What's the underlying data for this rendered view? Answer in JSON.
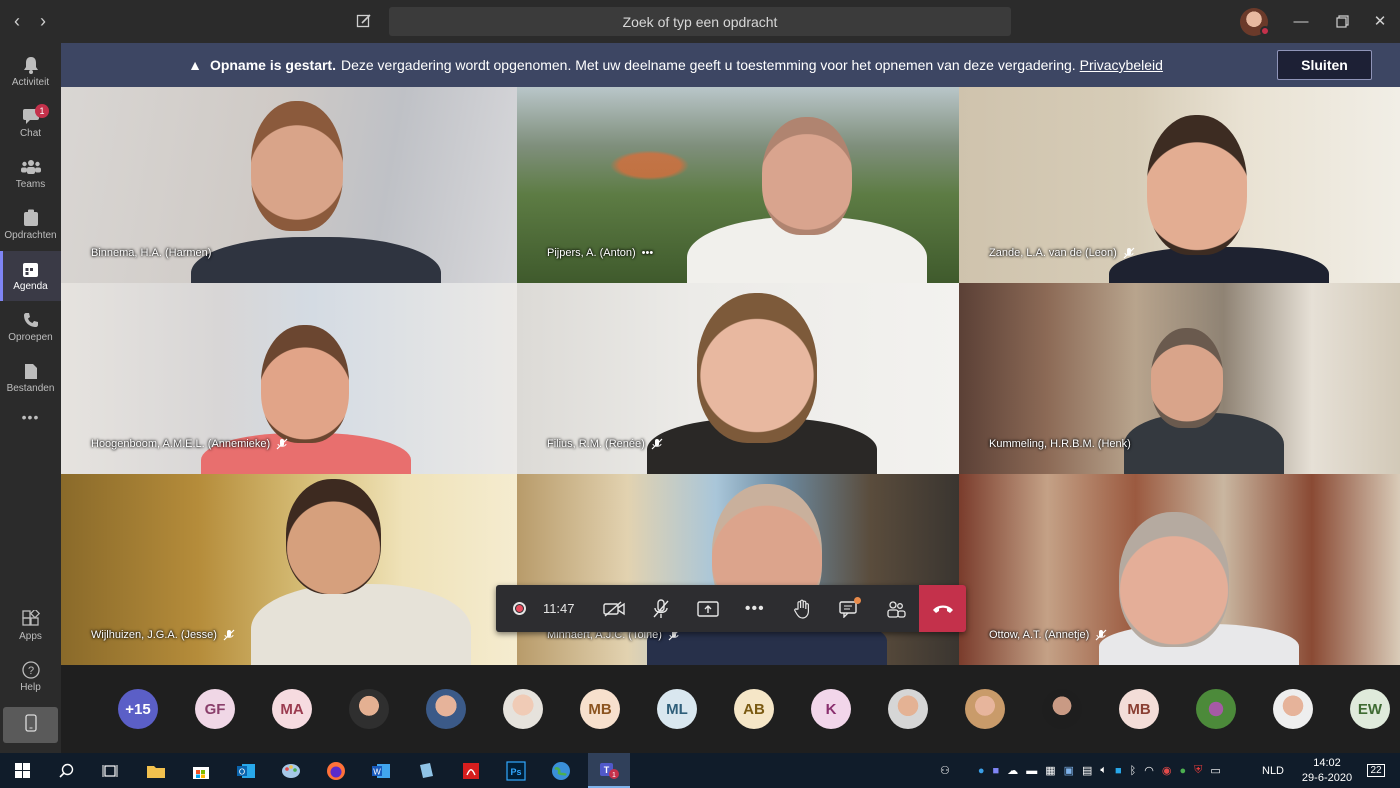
{
  "titlebar": {
    "search_placeholder": "Zoek of typ een opdracht"
  },
  "rail": {
    "items": [
      {
        "label": "Activiteit",
        "icon": "bell-icon"
      },
      {
        "label": "Chat",
        "icon": "chat-icon",
        "badge": "1"
      },
      {
        "label": "Teams",
        "icon": "teams-icon"
      },
      {
        "label": "Opdrachten",
        "icon": "assignments-icon"
      },
      {
        "label": "Agenda",
        "icon": "calendar-icon",
        "active": true
      },
      {
        "label": "Oproepen",
        "icon": "phone-icon"
      },
      {
        "label": "Bestanden",
        "icon": "files-icon"
      }
    ],
    "more": "•••",
    "bottom": [
      {
        "label": "Apps",
        "icon": "apps-icon"
      },
      {
        "label": "Help",
        "icon": "help-icon"
      }
    ]
  },
  "banner": {
    "title": "Opname is gestart.",
    "message": "Deze vergadering wordt opgenomen. Met uw deelname geeft u toestemming voor het opnemen van deze vergadering.",
    "link": "Privacybeleid",
    "close_label": "Sluiten"
  },
  "participants": [
    {
      "name": "Binnema, H.A. (Harmen)",
      "muted": false
    },
    {
      "name": "Pijpers, A. (Anton)",
      "muted": false,
      "more": "•••"
    },
    {
      "name": "Zande, L.A. van de (Leon)",
      "muted": true
    },
    {
      "name": "Hoogenboom, A.M.E.L. (Annemieke)",
      "muted": true
    },
    {
      "name": "Filius, R.M. (Renée)",
      "muted": true
    },
    {
      "name": "Kummeling, H.R.B.M. (Henk)",
      "muted": false
    },
    {
      "name": "Wijlhuizen, J.G.A. (Jesse)",
      "muted": true
    },
    {
      "name": "Minnaert, A.J.C. (Toine)",
      "muted": true
    },
    {
      "name": "Ottow, A.T. (Annetje)",
      "muted": true
    }
  ],
  "controls": {
    "timer": "11:47"
  },
  "roster": [
    {
      "initials": "+15",
      "bg": "#5b5fc7",
      "fg": "#ffffff"
    },
    {
      "initials": "GF",
      "bg": "#f0d7e6",
      "fg": "#8a3f6b"
    },
    {
      "initials": "MA",
      "bg": "#f6dbe0",
      "fg": "#9b3b4f"
    },
    {
      "initials": "",
      "photo": true
    },
    {
      "initials": "",
      "photo": true
    },
    {
      "initials": "",
      "photo": true
    },
    {
      "initials": "MB",
      "bg": "#f7e0cd",
      "fg": "#8c5420"
    },
    {
      "initials": "ML",
      "bg": "#d9e7ef",
      "fg": "#2f5f7a"
    },
    {
      "initials": "AB",
      "bg": "#f5e6c7",
      "fg": "#7a5a12"
    },
    {
      "initials": "K",
      "bg": "#f2d6ea",
      "fg": "#8a2f6e"
    },
    {
      "initials": "",
      "photo": true
    },
    {
      "initials": "",
      "photo": true
    },
    {
      "initials": "",
      "photo": true
    },
    {
      "initials": "MB",
      "bg": "#f3ddd8",
      "fg": "#8a3f33"
    },
    {
      "initials": "",
      "photo": true
    },
    {
      "initials": "",
      "photo": true
    },
    {
      "initials": "EW",
      "bg": "#dfeadb",
      "fg": "#3f6b33"
    }
  ],
  "taskbar": {
    "language": "NLD",
    "time": "14:02",
    "date": "29-6-2020",
    "notifications": "22"
  }
}
